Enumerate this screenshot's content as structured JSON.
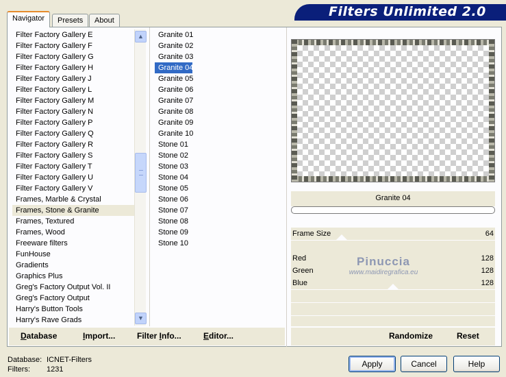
{
  "tabs": [
    "Navigator",
    "Presets",
    "About"
  ],
  "banner": "Filters Unlimited 2.0",
  "categories": [
    "Filter Factory Gallery E",
    "Filter Factory Gallery F",
    "Filter Factory Gallery G",
    "Filter Factory Gallery H",
    "Filter Factory Gallery J",
    "Filter Factory Gallery L",
    "Filter Factory Gallery M",
    "Filter Factory Gallery N",
    "Filter Factory Gallery P",
    "Filter Factory Gallery Q",
    "Filter Factory Gallery R",
    "Filter Factory Gallery S",
    "Filter Factory Gallery T",
    "Filter Factory Gallery U",
    "Filter Factory Gallery V",
    "Frames, Marble & Crystal",
    "Frames, Stone & Granite",
    "Frames, Textured",
    "Frames, Wood",
    "Freeware filters",
    "FunHouse",
    "Gradients",
    "Graphics Plus",
    "Greg's Factory Output Vol. II",
    "Greg's Factory Output",
    "Harry's Button Tools",
    "Harry's Rave Grads"
  ],
  "selected_category": "Frames, Stone & Granite",
  "filters": [
    "Granite 01",
    "Granite 02",
    "Granite 03",
    "Granite 04",
    "Granite 05",
    "Granite 06",
    "Granite 07",
    "Granite 08",
    "Granite 09",
    "Granite 10",
    "Stone 01",
    "Stone 02",
    "Stone 03",
    "Stone 04",
    "Stone 05",
    "Stone 06",
    "Stone 07",
    "Stone 08",
    "Stone 09",
    "Stone 10"
  ],
  "selected_filter": "Granite 04",
  "left_buttons": {
    "database": {
      "ul": "D",
      "rest": "atabase"
    },
    "import": {
      "ul": "I",
      "rest": "mport..."
    },
    "filter_info": {
      "pre": "Filter ",
      "ul": "I",
      "rest": "nfo..."
    },
    "editor": {
      "ul": "E",
      "rest": "ditor..."
    }
  },
  "preview_title": "Granite 04",
  "controls": {
    "frame_size": {
      "label": "Frame Size",
      "value": "64"
    },
    "red": {
      "label": "Red",
      "value": "128"
    },
    "green": {
      "label": "Green",
      "value": "128"
    },
    "blue": {
      "label": "Blue",
      "value": "128"
    }
  },
  "watermark": {
    "title": "Pinuccia",
    "subtitle": "www.maidiregrafica.eu"
  },
  "right_buttons": {
    "randomize": "Randomize",
    "reset": "Reset"
  },
  "status": {
    "database_label": "Database:",
    "database_value": "ICNET-Filters",
    "filters_label": "Filters:",
    "filters_value": "1231"
  },
  "dialog_buttons": {
    "apply": "Apply",
    "cancel": "Cancel",
    "help": "Help"
  },
  "colors": {
    "selection": "#316ac5",
    "banner": "#0a1f7a",
    "tab_accent": "#e68b2c"
  }
}
